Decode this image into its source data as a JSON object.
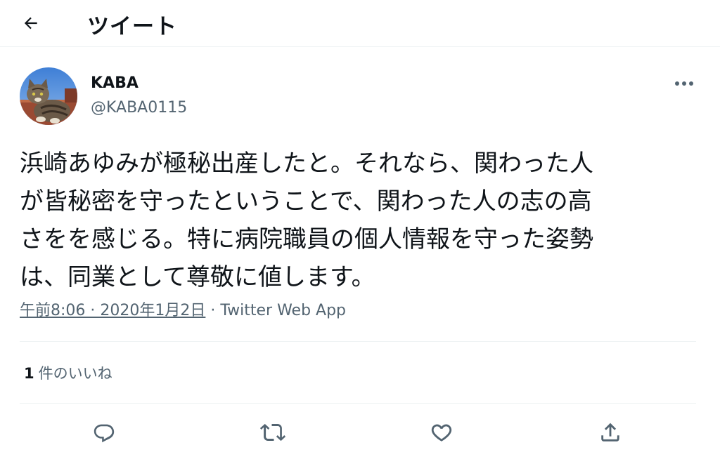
{
  "header": {
    "title": "ツイート",
    "back_icon": "arrow-left-icon"
  },
  "author": {
    "name": "KABA",
    "handle": "@KABA0115",
    "avatar": "cat-photo-avatar"
  },
  "tweet": {
    "text": "浜崎あゆみが極秘出産したと。それなら、関わった人\nが皆秘密を守ったということで、関わった人の志の高\nさをを感じる。特に病院職員の個人情報を守った姿勢\nは、同業として尊敬に値します。",
    "timestamp": "午前8:06 · 2020年1月2日",
    "separator": " · ",
    "source": "Twitter Web App"
  },
  "stats": {
    "likes_count": "1",
    "likes_label": "件のいいね"
  },
  "actions": [
    {
      "name": "reply",
      "icon": "reply-icon"
    },
    {
      "name": "retweet",
      "icon": "retweet-icon"
    },
    {
      "name": "like",
      "icon": "heart-icon"
    },
    {
      "name": "share",
      "icon": "share-icon"
    }
  ],
  "colors": {
    "text_primary": "#0f1419",
    "text_secondary": "#536471",
    "divider": "#eff3f4"
  }
}
